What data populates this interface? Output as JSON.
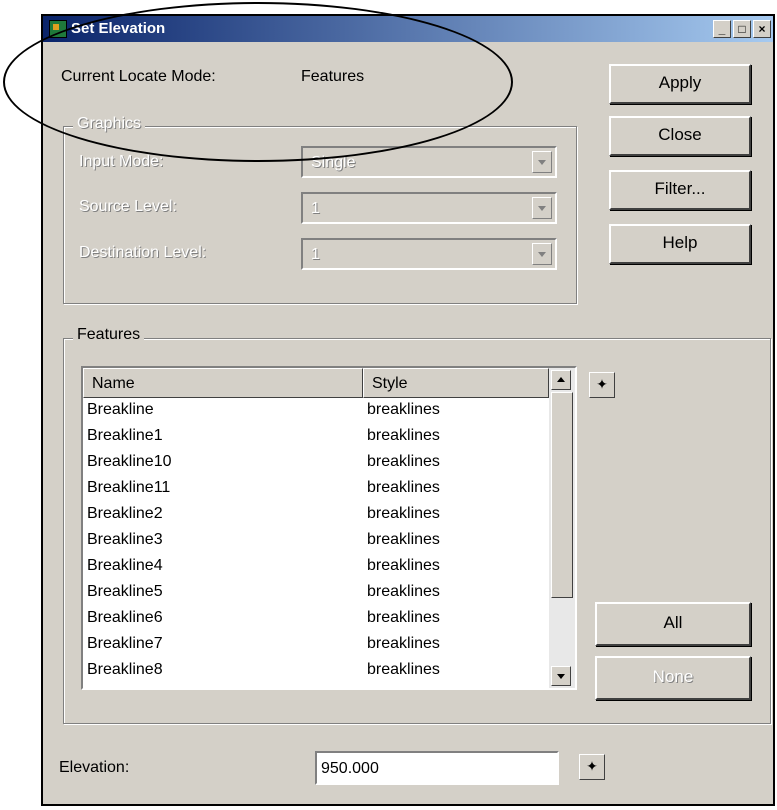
{
  "window": {
    "title": "Set Elevation"
  },
  "locate_mode": {
    "label": "Current Locate Mode:",
    "value": "Features"
  },
  "graphics": {
    "title": "Graphics",
    "input_mode": {
      "label": "Input Mode:",
      "value": "Single"
    },
    "source_level": {
      "label": "Source Level:",
      "value": "1"
    },
    "destination_level": {
      "label": "Destination Level:",
      "value": "1"
    }
  },
  "buttons": {
    "apply": "Apply",
    "close": "Close",
    "filter": "Filter...",
    "help": "Help",
    "all": "All",
    "none": "None"
  },
  "features": {
    "title": "Features",
    "columns": [
      "Name",
      "Style"
    ],
    "rows": [
      [
        "Breakline",
        "breaklines"
      ],
      [
        "Breakline1",
        "breaklines"
      ],
      [
        "Breakline10",
        "breaklines"
      ],
      [
        "Breakline11",
        "breaklines"
      ],
      [
        "Breakline2",
        "breaklines"
      ],
      [
        "Breakline3",
        "breaklines"
      ],
      [
        "Breakline4",
        "breaklines"
      ],
      [
        "Breakline5",
        "breaklines"
      ],
      [
        "Breakline6",
        "breaklines"
      ],
      [
        "Breakline7",
        "breaklines"
      ],
      [
        "Breakline8",
        "breaklines"
      ]
    ]
  },
  "elevation": {
    "label": "Elevation:",
    "value": "950.000"
  },
  "icons": {
    "pick": "crosshair-pick-icon",
    "minimize": "minimize-icon",
    "maximize": "maximize-icon",
    "close": "close-icon"
  }
}
